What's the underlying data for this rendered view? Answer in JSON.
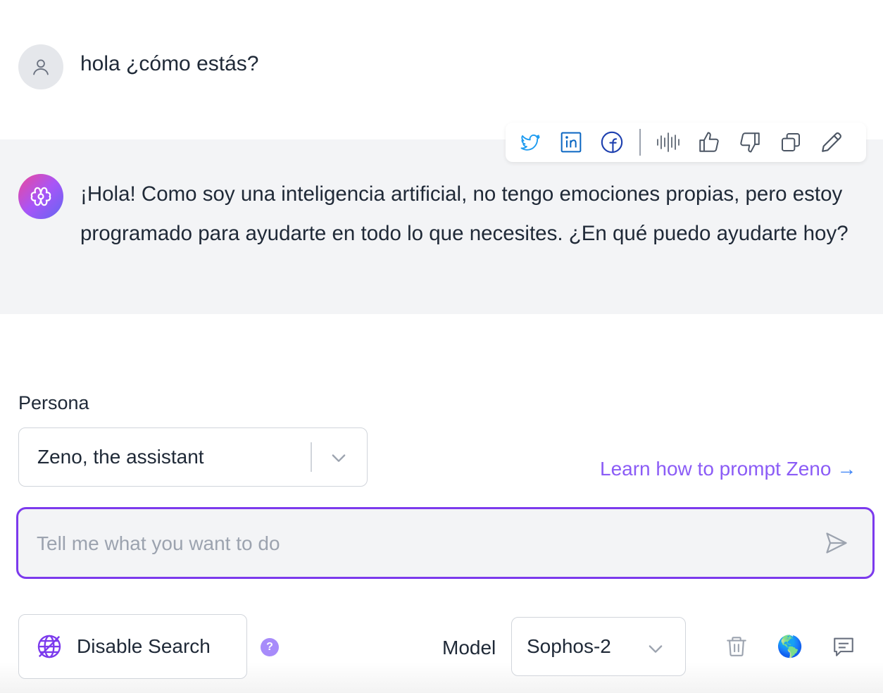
{
  "conversation": {
    "user_message": "hola ¿cómo estás?",
    "assistant_message": "¡Hola! Como soy una inteligencia artificial, no tengo emociones propias, pero estoy programado para ayudarte en todo lo que necesites. ¿En qué puedo ayudarte hoy?"
  },
  "toolbar": {
    "icons": [
      "twitter-icon",
      "linkedin-icon",
      "facebook-icon",
      "audio-wave-icon",
      "thumbs-up-icon",
      "thumbs-down-icon",
      "copy-icon",
      "pencil-icon"
    ]
  },
  "persona": {
    "label": "Persona",
    "selected": "Zeno, the assistant"
  },
  "learn_link": {
    "label": "Learn how to prompt Zeno",
    "arrow": "→"
  },
  "prompt": {
    "placeholder": "Tell me what you want to do",
    "value": ""
  },
  "bottom_bar": {
    "disable_search_label": "Disable Search",
    "help_label": "?",
    "model_label": "Model",
    "model_selected": "Sophos-2",
    "globe_emoji": "🌎"
  },
  "colors": {
    "accent": "#7c3aed",
    "link": "#8b5cf6",
    "twitter": "#1d9bf0",
    "linkedin": "#0a66c2",
    "facebook": "#1e40af",
    "assistant_bg": "#f3f4f6"
  }
}
